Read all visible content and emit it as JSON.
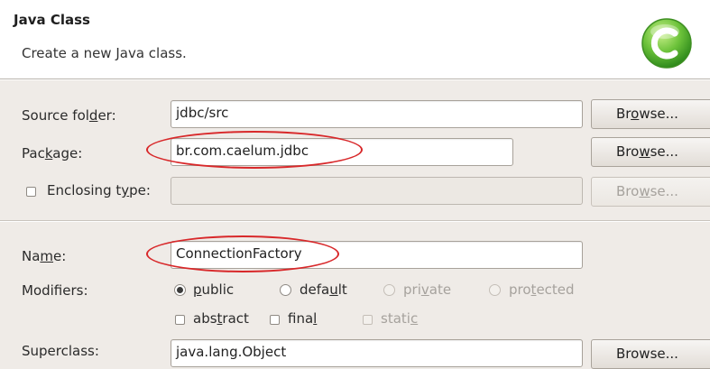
{
  "header": {
    "title": "Java Class",
    "subtitle": "Create a new Java class."
  },
  "form": {
    "source_folder": {
      "label_pre": "Source fol",
      "label_u": "d",
      "label_post": "er:",
      "value": "jdbc/src",
      "browse_pre": "Br",
      "browse_u": "o",
      "browse_post": "wse..."
    },
    "package": {
      "label_pre": "Pac",
      "label_u": "k",
      "label_post": "age:",
      "value": "br.com.caelum.jdbc",
      "browse_pre": "Bro",
      "browse_u": "w",
      "browse_post": "se..."
    },
    "enclosing_type": {
      "label_pre": "Enclosing t",
      "label_u": "y",
      "label_post": "pe:",
      "value": "",
      "browse_pre": "Bro",
      "browse_u": "w",
      "browse_post": "se..."
    },
    "name": {
      "label_pre": "Na",
      "label_u": "m",
      "label_post": "e:",
      "value": "ConnectionFactory"
    },
    "modifiers": {
      "label": "Modifiers:",
      "public": {
        "pre": "",
        "u": "p",
        "post": "ublic"
      },
      "default": {
        "pre": "defa",
        "u": "u",
        "post": "lt"
      },
      "private": {
        "pre": "pri",
        "u": "v",
        "post": "ate"
      },
      "protected": {
        "pre": "pro",
        "u": "t",
        "post": "ected"
      },
      "abstract": {
        "pre": "abs",
        "u": "t",
        "post": "ract"
      },
      "final": {
        "pre": "fina",
        "u": "l",
        "post": ""
      },
      "static": {
        "pre": "stati",
        "u": "c",
        "post": ""
      }
    },
    "superclass": {
      "label": "Superclass:",
      "value": "java.lang.Object",
      "browse": "Browse..."
    }
  },
  "colors": {
    "highlight_ellipse": "#d8282a",
    "logo_green": "#5cb82e"
  }
}
